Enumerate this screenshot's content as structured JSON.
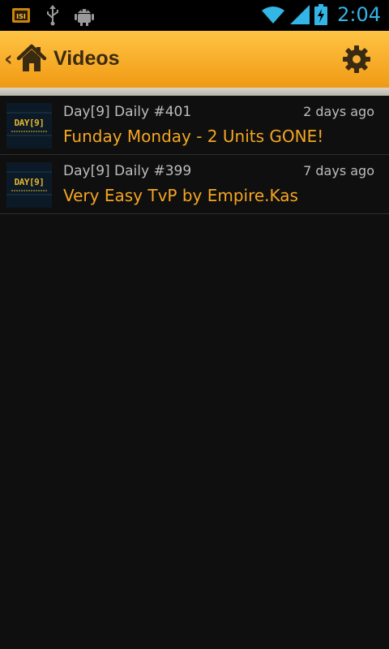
{
  "status_bar": {
    "time": "2:04",
    "icons": [
      "notification-app-icon",
      "usb-icon",
      "android-debug-icon",
      "wifi-icon",
      "signal-icon",
      "battery-charging-icon"
    ]
  },
  "action_bar": {
    "title": "Videos",
    "back_glyph": "‹",
    "home_icon": "home-icon",
    "settings_icon": "gear-icon"
  },
  "videos": [
    {
      "subtitle": "Day[9] Daily #401",
      "age": "2 days ago",
      "title": "Funday Monday - 2 Units GONE!",
      "thumb_text": "DAY[9]"
    },
    {
      "subtitle": "Day[9] Daily #399",
      "age": "7 days ago",
      "title": "Very Easy TvP by Empire.Kas",
      "thumb_text": "DAY[9]"
    }
  ],
  "colors": {
    "accent_orange": "#f5a623",
    "action_bar_top": "#ffc444",
    "action_bar_bottom": "#f09a14",
    "time_blue": "#33b5e5"
  }
}
